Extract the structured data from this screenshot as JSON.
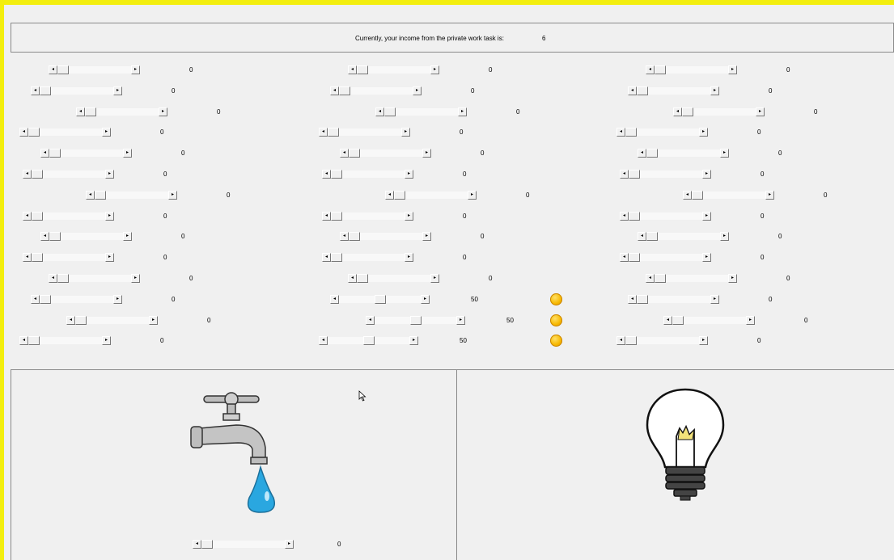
{
  "header": {
    "label": "Currently, your income from the private work task is:",
    "value": "6"
  },
  "columns": [
    {
      "rows": [
        {
          "value": "0"
        },
        {
          "value": "0"
        },
        {
          "value": "0"
        },
        {
          "value": "0"
        },
        {
          "value": "0"
        },
        {
          "value": "0"
        },
        {
          "value": "0"
        },
        {
          "value": "0"
        },
        {
          "value": "0"
        },
        {
          "value": "0"
        },
        {
          "value": "0"
        },
        {
          "value": "0"
        },
        {
          "value": "0"
        },
        {
          "value": "0"
        }
      ]
    },
    {
      "rows": [
        {
          "value": "0"
        },
        {
          "value": "0"
        },
        {
          "value": "0"
        },
        {
          "value": "0"
        },
        {
          "value": "0"
        },
        {
          "value": "0"
        },
        {
          "value": "0"
        },
        {
          "value": "0"
        },
        {
          "value": "0"
        },
        {
          "value": "0"
        },
        {
          "value": "0"
        },
        {
          "value": "50",
          "coin": true
        },
        {
          "value": "50",
          "coin": true
        },
        {
          "value": "50",
          "coin": true
        }
      ]
    },
    {
      "rows": [
        {
          "value": "0"
        },
        {
          "value": "0"
        },
        {
          "value": "0"
        },
        {
          "value": "0"
        },
        {
          "value": "0"
        },
        {
          "value": "0"
        },
        {
          "value": "0"
        },
        {
          "value": "0"
        },
        {
          "value": "0"
        },
        {
          "value": "0"
        },
        {
          "value": "0"
        },
        {
          "value": "0"
        },
        {
          "value": "0"
        },
        {
          "value": "0"
        }
      ]
    }
  ],
  "bottom": {
    "left_slider_value": "0",
    "left_icon": "water-tap-icon",
    "right_icon": "light-bulb-icon"
  },
  "colors": {
    "frame": "#f3ee0e",
    "coin": "#f7b800",
    "water": "#2aa7e0"
  }
}
